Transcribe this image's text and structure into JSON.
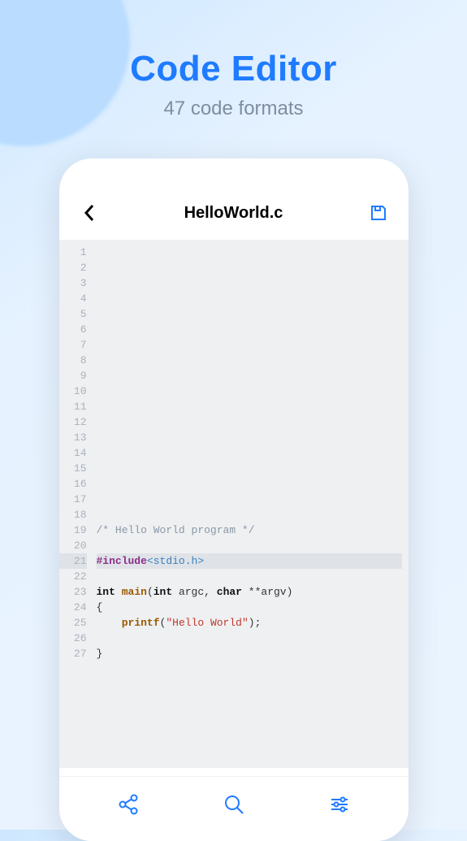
{
  "hero": {
    "title": "Code Editor",
    "subtitle": "47 code formats"
  },
  "app": {
    "filename": "HelloWorld.c"
  },
  "editor": {
    "line_count": 27,
    "active_line": 21,
    "lines": [
      {
        "n": 1,
        "tokens": []
      },
      {
        "n": 2,
        "tokens": []
      },
      {
        "n": 3,
        "tokens": []
      },
      {
        "n": 4,
        "tokens": []
      },
      {
        "n": 5,
        "tokens": []
      },
      {
        "n": 6,
        "tokens": []
      },
      {
        "n": 7,
        "tokens": []
      },
      {
        "n": 8,
        "tokens": []
      },
      {
        "n": 9,
        "tokens": []
      },
      {
        "n": 10,
        "tokens": []
      },
      {
        "n": 11,
        "tokens": []
      },
      {
        "n": 12,
        "tokens": []
      },
      {
        "n": 13,
        "tokens": []
      },
      {
        "n": 14,
        "tokens": []
      },
      {
        "n": 15,
        "tokens": []
      },
      {
        "n": 16,
        "tokens": []
      },
      {
        "n": 17,
        "tokens": []
      },
      {
        "n": 18,
        "tokens": []
      },
      {
        "n": 19,
        "tokens": [
          {
            "t": "/* Hello World program */",
            "c": "tok-comment"
          }
        ]
      },
      {
        "n": 20,
        "tokens": []
      },
      {
        "n": 21,
        "tokens": [
          {
            "t": "#include",
            "c": "tok-preproc"
          },
          {
            "t": "<stdio.h>",
            "c": "tok-include"
          }
        ]
      },
      {
        "n": 22,
        "tokens": []
      },
      {
        "n": 23,
        "tokens": [
          {
            "t": "int ",
            "c": "tok-keyword"
          },
          {
            "t": "main",
            "c": "tok-func"
          },
          {
            "t": "(",
            "c": "tok-punct"
          },
          {
            "t": "int",
            "c": "tok-keyword"
          },
          {
            "t": " argc, ",
            "c": "tok-punct"
          },
          {
            "t": "char",
            "c": "tok-keyword"
          },
          {
            "t": " **argv)",
            "c": "tok-punct"
          }
        ]
      },
      {
        "n": 24,
        "tokens": [
          {
            "t": "{",
            "c": "tok-punct"
          }
        ]
      },
      {
        "n": 25,
        "tokens": [
          {
            "t": "    ",
            "c": ""
          },
          {
            "t": "printf",
            "c": "tok-func"
          },
          {
            "t": "(",
            "c": "tok-punct"
          },
          {
            "t": "\"Hello World\"",
            "c": "tok-string"
          },
          {
            "t": ");",
            "c": "tok-punct"
          }
        ]
      },
      {
        "n": 26,
        "tokens": []
      },
      {
        "n": 27,
        "tokens": [
          {
            "t": "}",
            "c": "tok-punct"
          }
        ]
      }
    ]
  },
  "icons": {
    "back": "back-icon",
    "save": "save-icon",
    "share": "share-icon",
    "search": "search-icon",
    "settings": "settings-icon"
  }
}
